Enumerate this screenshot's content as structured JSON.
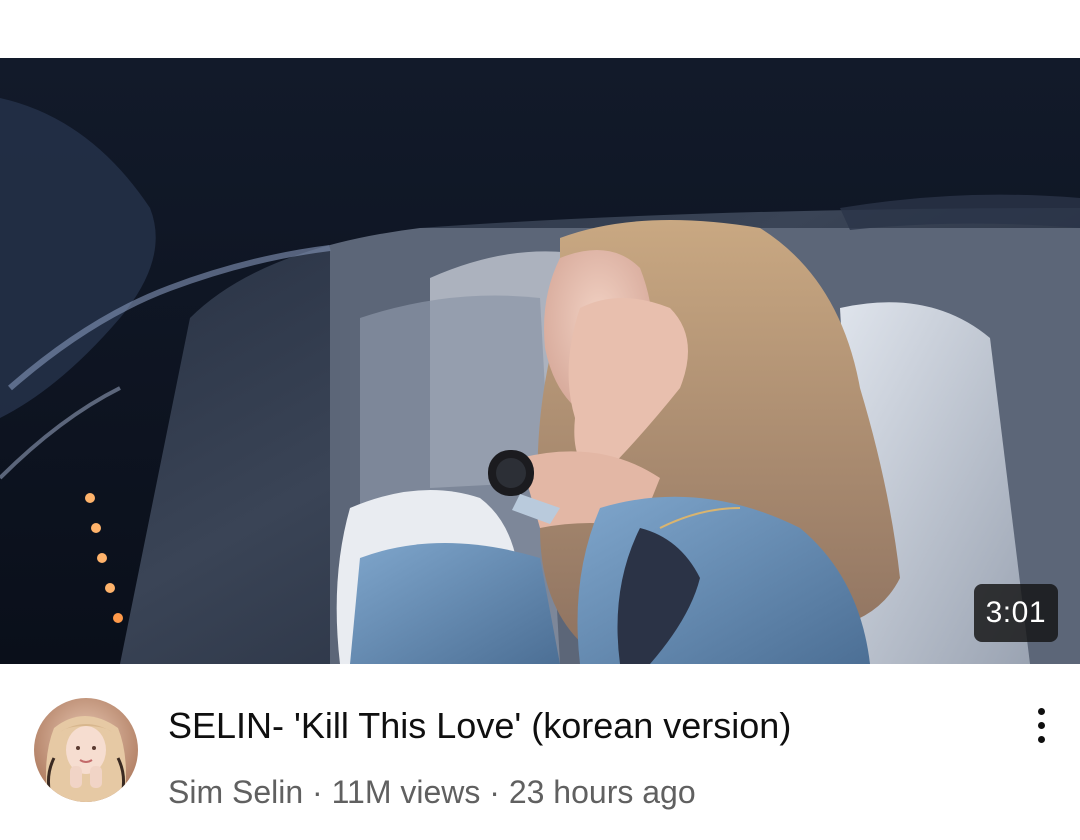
{
  "video": {
    "duration": "3:01",
    "title": "SELIN- 'Kill This Love' (korean version)",
    "channel": "Sim Selin",
    "separator": " · ",
    "views": "11M views",
    "published": "23 hours ago"
  },
  "icons": {
    "more": "more-vertical-icon"
  },
  "colors": {
    "title": "#0f0f0f",
    "secondary_text": "#606060",
    "badge_bg": "#141414",
    "background": "#ffffff"
  }
}
